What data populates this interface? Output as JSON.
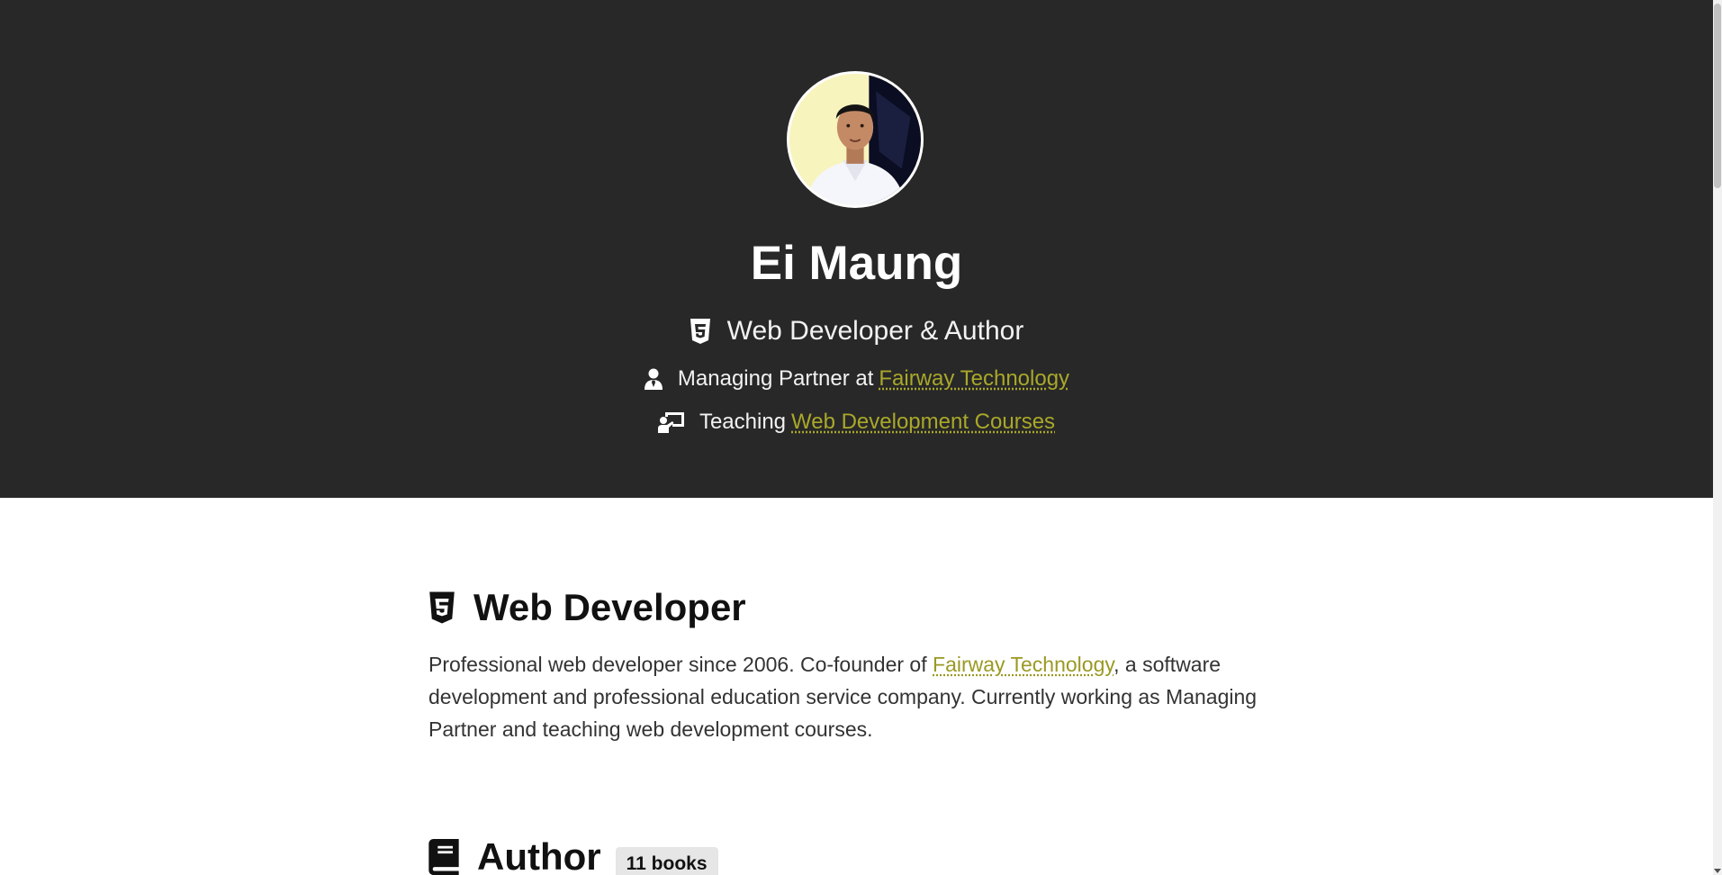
{
  "profile": {
    "name": "Ei Maung",
    "tagline": "Web Developer & Author",
    "role_prefix": "Managing Partner at",
    "role_link": "Fairway Technology",
    "teaching_prefix": "Teaching",
    "teaching_link": "Web Development Courses"
  },
  "sections": {
    "developer": {
      "title": "Web Developer",
      "body_before": "Professional web developer since 2006. Co-founder of ",
      "body_link": "Fairway Technology",
      "body_after": ", a software development and professional education service company. Currently working as Managing Partner and teaching web development courses."
    },
    "author": {
      "title": "Author",
      "badge": "11 books"
    }
  },
  "icons": {
    "tagline": "html5-icon",
    "role": "user-tie-icon",
    "teaching": "chalkboard-teacher-icon",
    "developer": "html5-icon",
    "author": "book-icon"
  },
  "colors": {
    "hero_bg": "#282828",
    "link": "#a9a82a",
    "badge_bg": "#e6e6e6"
  }
}
